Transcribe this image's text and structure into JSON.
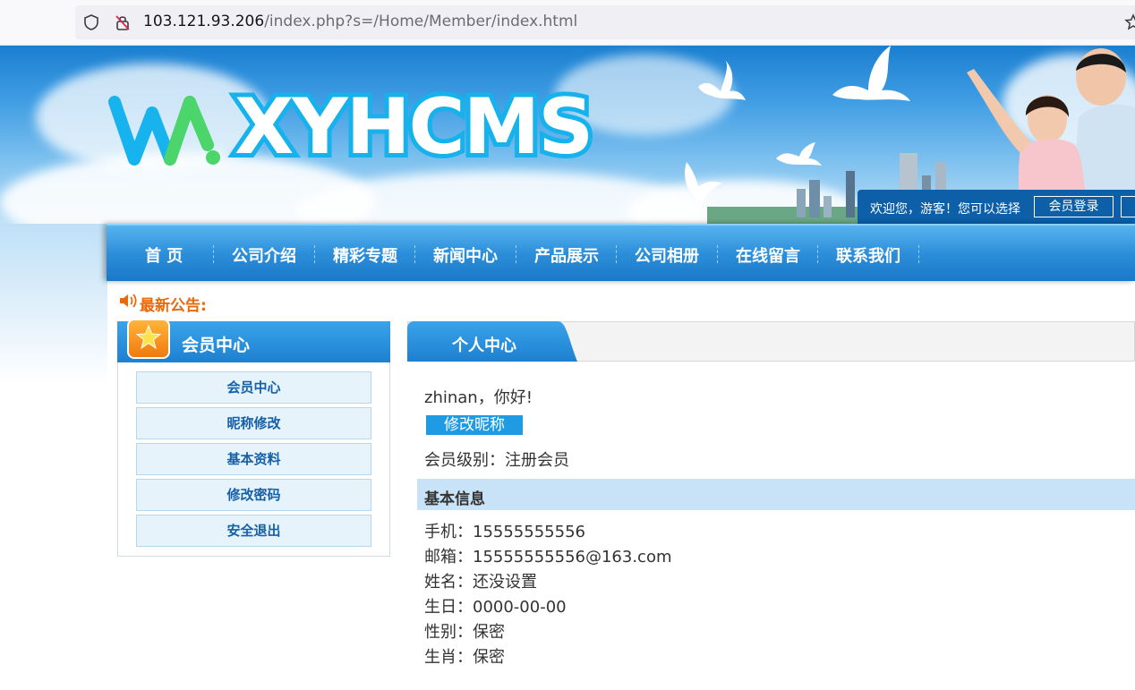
{
  "browser": {
    "url_host": "103.121.93.206",
    "url_path": "/index.php?s=/Home/Member/index.html"
  },
  "header": {
    "logo_text": "XYHCMS",
    "welcome": "欢迎您，游客！您可以选择",
    "login_button": "会员登录"
  },
  "nav": {
    "items": [
      "首 页",
      "公司介绍",
      "精彩专题",
      "新闻中心",
      "产品展示",
      "公司相册",
      "在线留言",
      "联系我们"
    ]
  },
  "notice": {
    "label": "最新公告:"
  },
  "sidebar": {
    "title": "会员中心",
    "links": [
      "会员中心",
      "昵称修改",
      "基本资料",
      "修改密码",
      "安全退出"
    ]
  },
  "main": {
    "tab": "个人中心",
    "greeting": "zhinan，你好!",
    "edit_nickname_button": "修改昵称",
    "level": "会员级别：注册会员",
    "info_title": "基本信息",
    "info": {
      "phone": "手机：15555555556",
      "email": "邮箱：15555555556@163.com",
      "name": "姓名：还没设置",
      "birthday": "生日：0000-00-00",
      "gender": "性别：保密",
      "zodiac": "生肖：保密"
    }
  },
  "colors": {
    "nav_blue": "#1a78c8",
    "notice_orange": "#e86a0b",
    "link_blue": "#1560a8",
    "button_blue": "#1e9be3",
    "info_bar": "#c8e3f8"
  }
}
